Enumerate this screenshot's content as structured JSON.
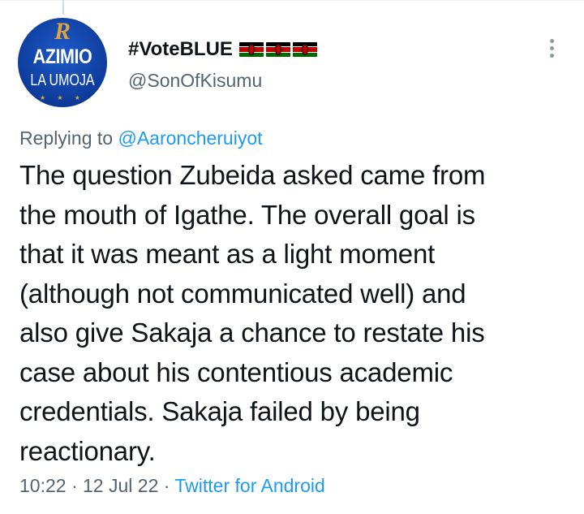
{
  "avatar": {
    "monogram": "R",
    "line1": "AZIMIO",
    "line2": "LA UMOJA",
    "stars": "★ ★ ★"
  },
  "author": {
    "display_name": "#VoteBLUE",
    "flag_count": 3,
    "flag_icon": "kenya-flag-icon",
    "handle": "@SonOfKisumu"
  },
  "more_icon": "more-vertical-icon",
  "reply": {
    "prefix": "Replying to ",
    "mention": "@Aaroncheruiyot"
  },
  "tweet": {
    "text": "The question Zubeida asked came from\nthe mouth of Igathe. The overall goal is\nthat it was meant as a light moment\n(although not communicated well) and\nalso give Sakaja a chance to restate his\ncase about his contentious academic\ncredentials. Sakaja failed by being\nreactionary."
  },
  "meta": {
    "time": "10:22",
    "sep1": " · ",
    "date": "12 Jul 22",
    "sep2": " · ",
    "source": "Twitter for Android"
  },
  "colors": {
    "text_primary": "#0f1419",
    "text_secondary": "#536471",
    "link": "#1d9bf0",
    "avatar_blue": "#0d3b9a",
    "avatar_gold": "#d9a441"
  }
}
